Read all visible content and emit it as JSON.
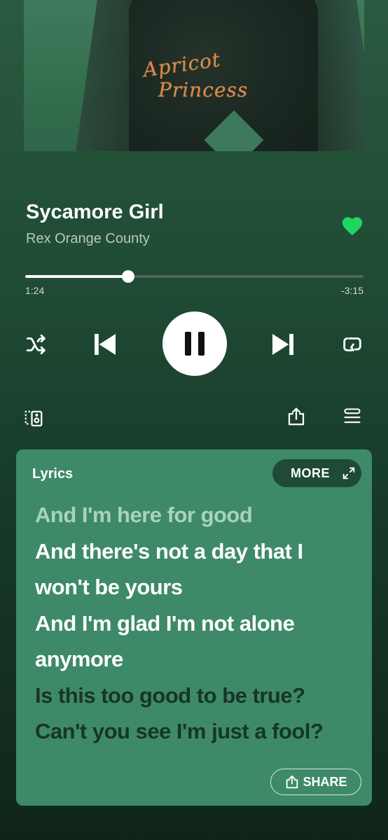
{
  "album_art": {
    "script_line_1": "Apricot",
    "script_line_2": "Princess"
  },
  "track": {
    "title": "Sycamore Girl",
    "artist": "Rex Orange County",
    "liked": true
  },
  "progress": {
    "elapsed": "1:24",
    "remaining": "-3:15",
    "fraction": 0.305
  },
  "controls": {
    "shuffle_icon": "shuffle-icon",
    "previous_icon": "skip-previous-icon",
    "pause_icon": "pause-icon",
    "next_icon": "skip-next-icon",
    "repeat_icon": "repeat-icon",
    "devices_icon": "connect-device-icon",
    "share_icon": "share-icon",
    "queue_icon": "queue-icon"
  },
  "lyrics": {
    "label": "Lyrics",
    "more_label": "MORE",
    "share_label": "SHARE",
    "lines": [
      {
        "text": "And I'm here for good",
        "state": "past"
      },
      {
        "text": "And there's not a day that I",
        "state": "current"
      },
      {
        "text": "won't be yours",
        "state": "current"
      },
      {
        "text": "And I'm glad I'm not alone",
        "state": "current"
      },
      {
        "text": "anymore",
        "state": "current"
      },
      {
        "text": "Is this too good to be true?",
        "state": "future"
      },
      {
        "text": "Can't you see I'm just a fool?",
        "state": "future"
      }
    ]
  },
  "colors": {
    "accent_green": "#1ed760",
    "lyrics_card": "#3e8a68",
    "more_button": "#1f4a36"
  }
}
